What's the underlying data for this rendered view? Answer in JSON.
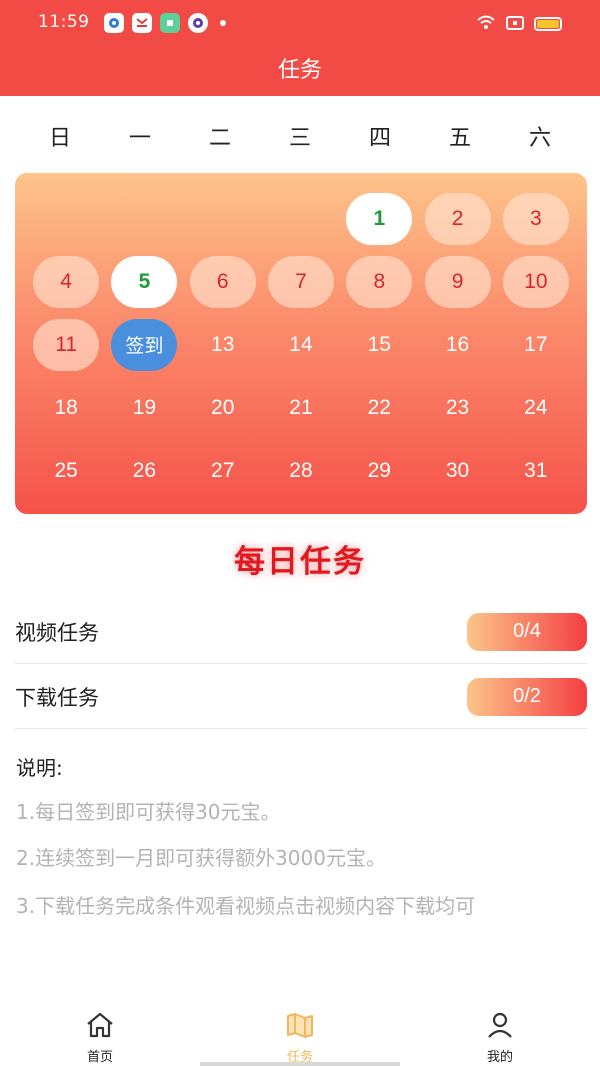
{
  "status_bar": {
    "time": "11:59",
    "app_icons": [
      "app-circle-icon",
      "app-shop-icon",
      "app-green-icon",
      "app-purple-icon"
    ]
  },
  "header": {
    "title": "任务"
  },
  "weekdays": [
    "日",
    "一",
    "二",
    "三",
    "四",
    "五",
    "六"
  ],
  "calendar": {
    "leading_blanks": 4,
    "days": [
      {
        "label": "1",
        "state": "green"
      },
      {
        "label": "2",
        "state": "done"
      },
      {
        "label": "3",
        "state": "done"
      },
      {
        "label": "4",
        "state": "done"
      },
      {
        "label": "5",
        "state": "green"
      },
      {
        "label": "6",
        "state": "done"
      },
      {
        "label": "7",
        "state": "done"
      },
      {
        "label": "8",
        "state": "done"
      },
      {
        "label": "9",
        "state": "done"
      },
      {
        "label": "10",
        "state": "done"
      },
      {
        "label": "11",
        "state": "done"
      },
      {
        "label": "签到",
        "state": "sign"
      },
      {
        "label": "13",
        "state": "plain"
      },
      {
        "label": "14",
        "state": "plain"
      },
      {
        "label": "15",
        "state": "plain"
      },
      {
        "label": "16",
        "state": "plain"
      },
      {
        "label": "17",
        "state": "plain"
      },
      {
        "label": "18",
        "state": "plain"
      },
      {
        "label": "19",
        "state": "plain"
      },
      {
        "label": "20",
        "state": "plain"
      },
      {
        "label": "21",
        "state": "plain"
      },
      {
        "label": "22",
        "state": "plain"
      },
      {
        "label": "23",
        "state": "plain"
      },
      {
        "label": "24",
        "state": "plain"
      },
      {
        "label": "25",
        "state": "plain"
      },
      {
        "label": "26",
        "state": "plain"
      },
      {
        "label": "27",
        "state": "plain"
      },
      {
        "label": "28",
        "state": "plain"
      },
      {
        "label": "29",
        "state": "plain"
      },
      {
        "label": "30",
        "state": "plain"
      },
      {
        "label": "31",
        "state": "plain"
      }
    ]
  },
  "daily": {
    "title": "每日任务",
    "tasks": [
      {
        "name": "视频任务",
        "progress": "0/4"
      },
      {
        "name": "下载任务",
        "progress": "0/2"
      }
    ]
  },
  "notes": {
    "title": "说明:",
    "items": [
      "1.每日签到即可获得30元宝。",
      "2.连续签到一月即可获得额外3000元宝。",
      "3.下载任务完成条件观看视频点击视频内容下载均可"
    ]
  },
  "nav": {
    "items": [
      {
        "label": "首页",
        "icon": "home-icon"
      },
      {
        "label": "任务",
        "icon": "map-icon",
        "active": true
      },
      {
        "label": "我的",
        "icon": "user-icon"
      }
    ]
  },
  "colors": {
    "header": "#f24a45",
    "accent_active": "#f0b85a",
    "sign_button": "#4a8fdd",
    "signed_day_text": "#1d9b3a",
    "done_day_text": "#d6262c"
  }
}
